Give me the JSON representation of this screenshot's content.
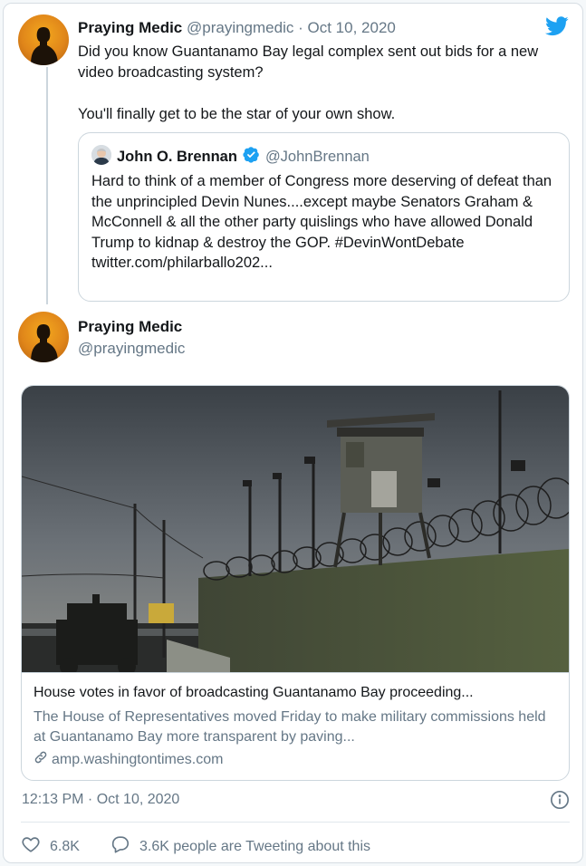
{
  "tweet1": {
    "display_name": "Praying Medic",
    "handle": "@prayingmedic",
    "separator": "·",
    "date": "Oct 10, 2020",
    "text_line1": "Did you know Guantanamo Bay legal complex sent out bids for a new video broadcasting system?",
    "text_line2": "You'll finally get to be the star of your own show."
  },
  "quoted_tweet": {
    "display_name": "John O. Brennan",
    "handle": "@JohnBrennan",
    "text": "Hard to think of a member of Congress more deserving of defeat than the unprincipled Devin Nunes....except maybe Senators Graham & McConnell & all the other party quislings who have allowed Donald Trump to kidnap & destroy the GOP. #DevinWontDebate twitter.com/philarballo202..."
  },
  "tweet2": {
    "display_name": "Praying Medic",
    "handle": "@prayingmedic"
  },
  "link_card": {
    "title": "House votes in favor of broadcasting Guantanamo Bay proceeding...",
    "description": "The House of Representatives moved Friday to make military commissions held at Guantanamo Bay more transparent by paving...",
    "domain": "amp.washingtontimes.com"
  },
  "footer": {
    "timestamp": "12:13 PM · Oct 10, 2020",
    "likes": "6.8K",
    "retweets_text": "3.6K people are Tweeting about this"
  },
  "icons": {
    "brand": "twitter-bird-icon",
    "verified": "verified-badge-icon",
    "link": "link-icon",
    "info": "info-icon",
    "like": "heart-icon",
    "reply": "speech-bubble-icon"
  },
  "colors": {
    "twitter_blue": "#1da1f2",
    "muted_text": "#657786",
    "border": "#ccd6dd"
  }
}
